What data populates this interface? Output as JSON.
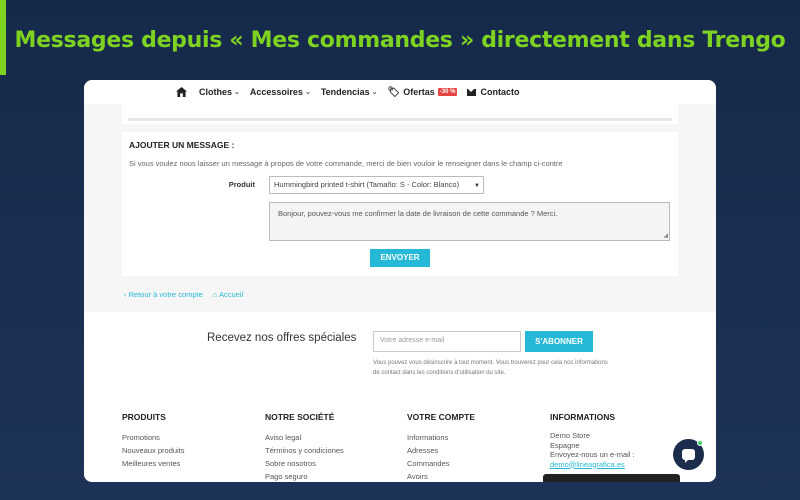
{
  "banner": {
    "title": "Messages depuis « Mes commandes » directement dans Trengo"
  },
  "nav": {
    "items": [
      {
        "label": "Clothes",
        "chevron": "⌄"
      },
      {
        "label": "Accessoires",
        "chevron": "⌄"
      },
      {
        "label": "Tendencias",
        "chevron": "⌄"
      }
    ],
    "ofertas": "Ofertas",
    "ofertas_badge": "-30 %",
    "contacto": "Contacto"
  },
  "message": {
    "heading": "AJOUTER UN MESSAGE :",
    "description": "Si vous voulez nous laisser un message à propos de votre commande, merci de bien vouloir le renseigner dans le champ ci-contre",
    "product_label": "Produit",
    "product_value": "Hummingbird printed t-shirt (Tamaño: S - Color: Blanco)",
    "textarea_value": "Bonjour, pouvez-vous me confirmer la date de livraison de cette commande ? Merci.",
    "send_label": "ENVOYER"
  },
  "links": {
    "back": "‹ Retour à votre compte",
    "home": "⌂ Accueil"
  },
  "newsletter": {
    "title": "Recevez nos offres spéciales",
    "placeholder": "Votre adresse e-mail",
    "button": "S'ABONNER",
    "note": "Vous pouvez vous désinscrire à tout moment. Vous trouverez pour cela nos informations de contact dans les conditions d'utilisation du site."
  },
  "footer": {
    "produits": {
      "title": "PRODUITS",
      "items": [
        "Promotions",
        "Nouveaux produits",
        "Meilleures ventes"
      ]
    },
    "societe": {
      "title": "NOTRE SOCIÉTÉ",
      "items": [
        "Aviso legal",
        "Términos y condiciones",
        "Sobre nosotros",
        "Pago seguro"
      ]
    },
    "compte": {
      "title": "VOTRE COMPTE",
      "items": [
        "Informations",
        "Adresses",
        "Commandes",
        "Avoirs"
      ]
    },
    "informations": {
      "title": "INFORMATIONS",
      "lines": [
        "Demo Store",
        "Espagne",
        "Envoyez-nous un e-mail :"
      ],
      "email": "demo@lineagrafica.es"
    }
  },
  "colors": {
    "accent_green": "#7ed321",
    "primary_blue": "#25b9d7",
    "badge_red": "#e64545"
  }
}
